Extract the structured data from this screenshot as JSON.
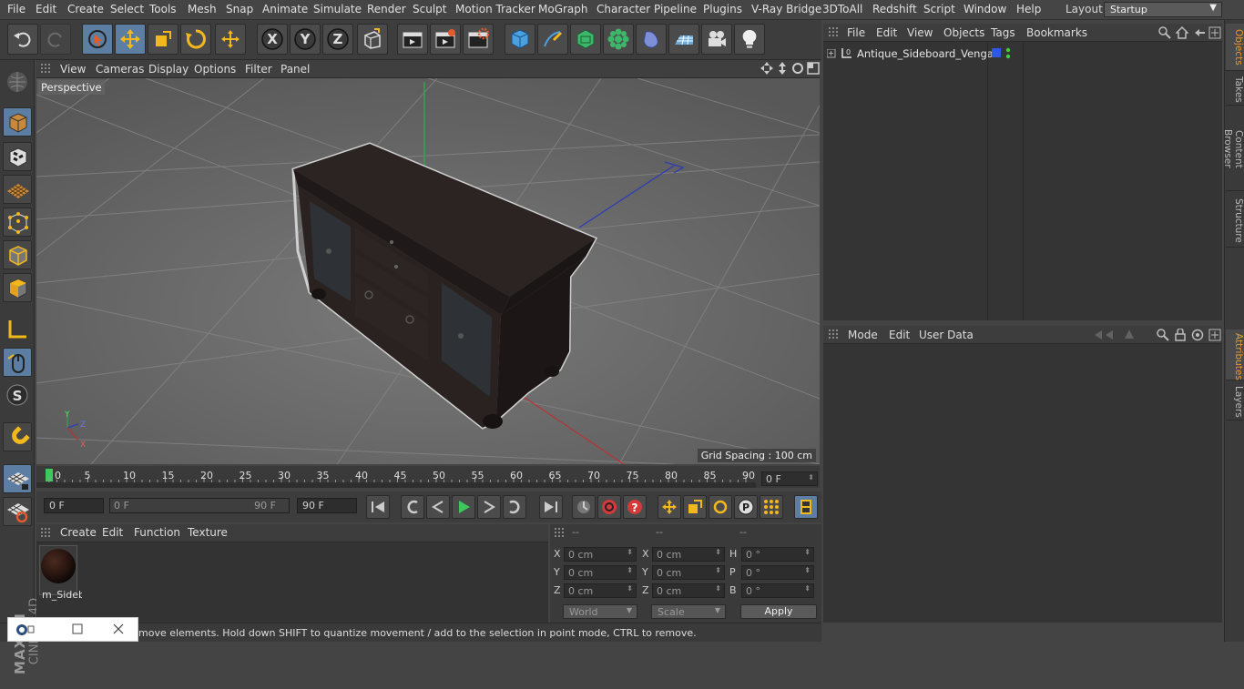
{
  "menubar": {
    "items": [
      "File",
      "Edit",
      "Create",
      "Select",
      "Tools",
      "Mesh",
      "Snap",
      "Animate",
      "Simulate",
      "Render",
      "Sculpt",
      "Motion Tracker",
      "MoGraph",
      "Character",
      "Pipeline",
      "Plugins",
      "V-Ray Bridge",
      "3DToAll",
      "Redshift",
      "Script",
      "Window",
      "Help"
    ],
    "layout_label": "Layout:",
    "layout_value": "Startup"
  },
  "toolbar": {
    "icons": [
      "undo-icon",
      "redo-icon",
      "live-select-icon",
      "move-icon",
      "scale-icon",
      "rotate-icon",
      "transform-icon",
      "x-axis-icon",
      "y-axis-icon",
      "z-axis-icon",
      "world-coordinates-icon",
      "render-view-icon",
      "render-picture-viewer-icon",
      "edit-render-settings-icon",
      "cube-primitive-icon",
      "pen-spline-icon",
      "subdivision-surface-icon",
      "cloner-icon",
      "deformer-icon",
      "floor-icon",
      "camera-icon",
      "light-icon"
    ],
    "axis_x": "X",
    "axis_y": "Y",
    "axis_z": "Z"
  },
  "lefttools": {
    "icons": [
      "make-editable-icon",
      "model-mode-icon",
      "texture-mode-icon",
      "workplane-icon",
      "points-mode-icon",
      "edges-mode-icon",
      "polygons-mode-icon",
      "axis-mode-icon",
      "tweak-mode-icon",
      "snap-icon",
      "magnet-icon",
      "workplane-lock-icon",
      "enable-snap-icon"
    ],
    "snap_letter": "S"
  },
  "brand": {
    "maxon": "MAXON",
    "product": "CINEMA 4D"
  },
  "viewport": {
    "menu": [
      "View",
      "Cameras",
      "Display",
      "Options",
      "Filter",
      "Panel"
    ],
    "label": "Perspective",
    "grid_spacing": "Grid Spacing : 100 cm",
    "axis_labels": {
      "y": "Y",
      "z": "Z",
      "x": "X"
    }
  },
  "timeline": {
    "ticks": [
      "0",
      "5",
      "10",
      "15",
      "20",
      "25",
      "30",
      "35",
      "40",
      "45",
      "50",
      "55",
      "60",
      "65",
      "70",
      "75",
      "80",
      "85",
      "90"
    ],
    "current_frame": "0 F"
  },
  "transport": {
    "start_field": "0 F",
    "range_start": "0 F",
    "range_end": "90 F",
    "end_field": "90 F",
    "buttons": [
      "go-to-start-icon",
      "previous-keyframe-icon",
      "previous-frame-icon",
      "play-icon",
      "next-frame-icon",
      "next-keyframe-icon",
      "go-to-end-icon",
      "autokey-icon",
      "record-icon",
      "keyframe-help-icon",
      "move-key-icon",
      "scale-key-icon",
      "rotate-key-icon",
      "param-key-icon",
      "pla-key-icon",
      "timeline-icon"
    ]
  },
  "materials": {
    "menu": [
      "Create",
      "Edit",
      "Function",
      "Texture"
    ],
    "items": [
      {
        "name": "m_Sideb",
        "color": "#2a1610"
      }
    ]
  },
  "coordinates": {
    "headers": [
      "--",
      "--",
      "--"
    ],
    "rows": [
      {
        "l1": "X",
        "v1": "0 cm",
        "l2": "X",
        "v2": "0 cm",
        "l3": "H",
        "v3": "0 °"
      },
      {
        "l1": "Y",
        "v1": "0 cm",
        "l2": "Y",
        "v2": "0 cm",
        "l3": "P",
        "v3": "0 °"
      },
      {
        "l1": "Z",
        "v1": "0 cm",
        "l2": "Z",
        "v2": "0 cm",
        "l3": "B",
        "v3": "0 °"
      }
    ],
    "mode_select": "World",
    "scale_select": "Scale",
    "apply": "Apply"
  },
  "status": {
    "text": "move elements. Hold down SHIFT to quantize movement / add to the selection in point mode, CTRL to remove."
  },
  "objects": {
    "menu": [
      "File",
      "Edit",
      "View",
      "Objects",
      "Tags",
      "Bookmarks"
    ],
    "items": [
      {
        "name": "Antique_Sideboard_Venga",
        "layer_color": "#2f57e8",
        "visible_color": "#3dd03d"
      }
    ]
  },
  "attributes": {
    "menu": [
      "Mode",
      "Edit",
      "User Data"
    ]
  },
  "right_tabs": [
    "Objects",
    "Takes",
    "Content Browser",
    "Structure",
    "Attributes",
    "Layers"
  ],
  "colors": {
    "accent": "#5d7ea3",
    "active_tab": "#e89a2c"
  }
}
